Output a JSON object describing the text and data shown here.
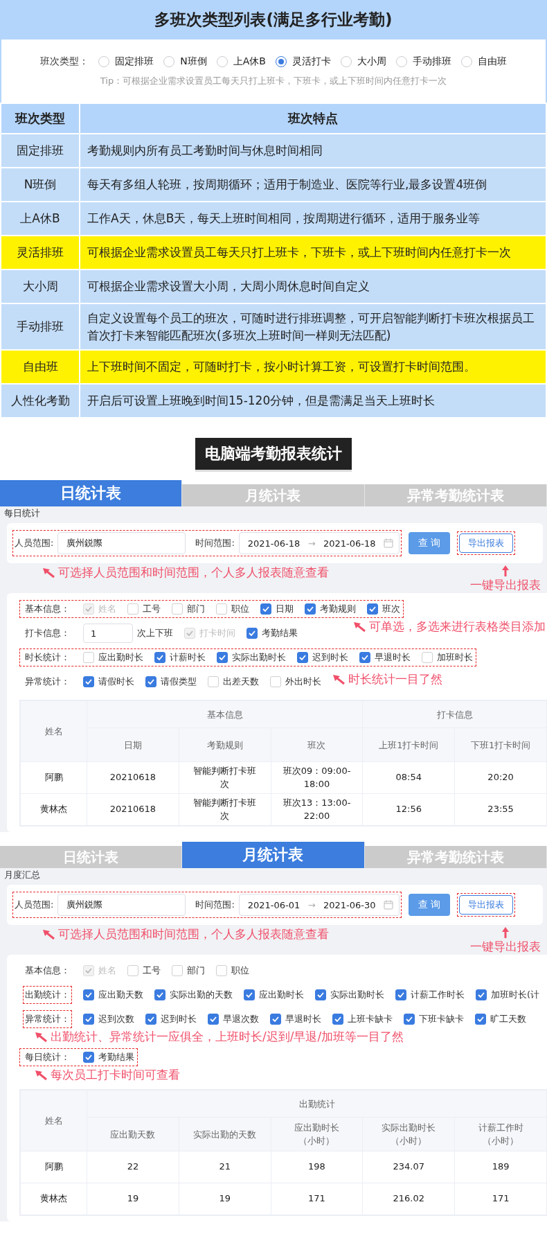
{
  "title": "多班次类型列表(满足多行业考勤)",
  "shift_selector": {
    "label": "班次类型：",
    "options": [
      {
        "label": "固定排班",
        "selected": false
      },
      {
        "label": "N班倒",
        "selected": false
      },
      {
        "label": "上A休B",
        "selected": false
      },
      {
        "label": "灵活打卡",
        "selected": true
      },
      {
        "label": "大小周",
        "selected": false
      },
      {
        "label": "手动排班",
        "selected": false
      },
      {
        "label": "自由班",
        "selected": false
      }
    ],
    "tip": "Tip：可根据企业需求设置员工每天只打上班卡，下班卡，或上下班时间内任意打卡一次"
  },
  "shift_table": {
    "columns": [
      "班次类型",
      "班次特点"
    ],
    "rows": [
      {
        "type": "固定排班",
        "feature": "考勤规则内所有员工考勤时间与休息时间相同",
        "highlighted": false
      },
      {
        "type": "N班倒",
        "feature": "每天有多组人轮班，按周期循环；适用于制造业、医院等行业,最多设置4班倒",
        "highlighted": false
      },
      {
        "type": "上A休B",
        "feature": "工作A天，休息B天，每天上班时间相同，按周期进行循环，适用于服务业等",
        "highlighted": false
      },
      {
        "type": "灵活排班",
        "feature": "可根据企业需求设置员工每天只打上班卡，下班卡，或上下班时间内任意打卡一次",
        "highlighted": true
      },
      {
        "type": "大小周",
        "feature": "可根据企业需求设置大小周，大周小周休息时间自定义",
        "highlighted": false
      },
      {
        "type": "手动排班",
        "feature": "自定义设置每个员工的班次，可随时进行排班调整，可开启智能判断打卡班次根据员工首次打卡来智能匹配班次(多班次上班时间一样则无法匹配)",
        "highlighted": false
      },
      {
        "type": "自由班",
        "feature": "上下班时间不固定，可随时打卡，按小时计算工资，可设置打卡时间范围。",
        "highlighted": true
      },
      {
        "type": "人性化考勤",
        "feature": "开启后可设置上班晚到时间15-120分钟，但是需满足当天上班时长",
        "highlighted": false
      }
    ]
  },
  "section_title": "电脑端考勤报表统计",
  "daily_report": {
    "tabs": [
      {
        "label": "日统计表",
        "selected": true
      },
      {
        "label": "月统计表",
        "selected": false
      },
      {
        "label": "异常考勤统计表",
        "selected": false
      }
    ],
    "subtitle": "每日统计",
    "filter": {
      "person_label": "人员范围:",
      "person_value": "廣州鋭際",
      "time_label": "时间范围:",
      "start": "2021-06-18",
      "range_arrow": "→",
      "end": "2021-06-18",
      "query_button": "查 询",
      "export_button": "导出报表"
    },
    "filter_note": "可选择人员范围和时间范围，个人多人报表随意查看",
    "export_note": "一键导出报表",
    "option_groups": [
      {
        "kind": "checks",
        "label": "基本信息：",
        "row_outlined": true,
        "label_outlined": false,
        "note": {
          "kind": "under-right",
          "text": "可单选，多选来进行表格类目添加"
        },
        "items": [
          {
            "label": "姓名",
            "checked": true,
            "disabled": true
          },
          {
            "label": "工号",
            "checked": false,
            "disabled": false
          },
          {
            "label": "部门",
            "checked": false,
            "disabled": false
          },
          {
            "label": "职位",
            "checked": false,
            "disabled": false
          },
          {
            "label": "日期",
            "checked": true,
            "disabled": false
          },
          {
            "label": "考勤规则",
            "checked": true,
            "disabled": false
          },
          {
            "label": "班次",
            "checked": true,
            "disabled": false
          }
        ]
      },
      {
        "kind": "count",
        "label": "打卡信息：",
        "row_outlined": false,
        "label_outlined": false,
        "value": "1",
        "suffix": "次上下班",
        "items": [
          {
            "label": "打卡时间",
            "checked": true,
            "disabled": true
          },
          {
            "label": "考勤结果",
            "checked": true,
            "disabled": false
          }
        ]
      },
      {
        "kind": "checks",
        "label": "时长统计：",
        "row_outlined": true,
        "label_outlined": false,
        "note": {
          "kind": "under-middle",
          "text": "时长统计一目了然"
        },
        "items": [
          {
            "label": "应出勤时长",
            "checked": false,
            "disabled": false
          },
          {
            "label": "计薪时长",
            "checked": true,
            "disabled": false
          },
          {
            "label": "实际出勤时长",
            "checked": true,
            "disabled": false
          },
          {
            "label": "迟到时长",
            "checked": true,
            "disabled": false
          },
          {
            "label": "早退时长",
            "checked": true,
            "disabled": false
          },
          {
            "label": "加班时长",
            "checked": false,
            "disabled": false
          }
        ]
      },
      {
        "kind": "checks",
        "label": "异常统计：",
        "row_outlined": false,
        "label_outlined": false,
        "items": [
          {
            "label": "请假时长",
            "checked": true,
            "disabled": false
          },
          {
            "label": "请假类型",
            "checked": true,
            "disabled": false
          },
          {
            "label": "出差天数",
            "checked": false,
            "disabled": false
          },
          {
            "label": "外出时长",
            "checked": false,
            "disabled": false
          }
        ]
      }
    ],
    "table": {
      "first_column": "姓名",
      "groups": [
        {
          "label": "基本信息",
          "columns": [
            {
              "label": "日期"
            },
            {
              "label": "考勤规则"
            },
            {
              "label": "班次"
            }
          ]
        },
        {
          "label": "打卡信息",
          "columns": [
            {
              "label": "上班1打卡时间"
            },
            {
              "label": "下班1打卡时间"
            }
          ]
        }
      ],
      "rows": [
        {
          "cells": [
            "阿鹏",
            "20210618",
            "智能判断打卡班次",
            "班次09：09:00-18:00",
            "08:54",
            "20:20"
          ]
        },
        {
          "cells": [
            "黄林杰",
            "20210618",
            "智能判断打卡班次",
            "班次13：13:00-22:00",
            "12:56",
            "23:55"
          ]
        }
      ]
    }
  },
  "monthly_report": {
    "tabs": [
      {
        "label": "日统计表",
        "selected": false
      },
      {
        "label": "月统计表",
        "selected": true
      },
      {
        "label": "异常考勤统计表",
        "selected": false
      }
    ],
    "subtitle": "月度汇总",
    "filter": {
      "person_label": "人员范围:",
      "person_value": "廣州鋭際",
      "time_label": "时间范围:",
      "start": "2021-06-01",
      "range_arrow": "→",
      "end": "2021-06-30",
      "query_button": "查 询",
      "export_button": "导出报表"
    },
    "filter_note": "可选择人员范围和时间范围，个人多人报表随意查看",
    "export_note": "一键导出报表",
    "option_groups": [
      {
        "kind": "checks",
        "label": "基本信息：",
        "row_outlined": false,
        "label_outlined": false,
        "items": [
          {
            "label": "姓名",
            "checked": true,
            "disabled": true
          },
          {
            "label": "工号",
            "checked": false,
            "disabled": false
          },
          {
            "label": "部门",
            "checked": false,
            "disabled": false
          },
          {
            "label": "职位",
            "checked": false,
            "disabled": false
          }
        ]
      },
      {
        "kind": "checks",
        "label": "出勤统计：",
        "row_outlined": false,
        "label_outlined": true,
        "items": [
          {
            "label": "应出勤天数",
            "checked": true,
            "disabled": false
          },
          {
            "label": "实际出勤的天数",
            "checked": true,
            "disabled": false
          },
          {
            "label": "应出勤时长",
            "checked": true,
            "disabled": false
          },
          {
            "label": "实际出勤时长",
            "checked": true,
            "disabled": false
          },
          {
            "label": "计薪工作时长",
            "checked": true,
            "disabled": false
          },
          {
            "label": "加班时长(计",
            "checked": true,
            "disabled": false
          }
        ]
      },
      {
        "kind": "checks",
        "label": "异常统计：",
        "row_outlined": false,
        "label_outlined": true,
        "note": {
          "kind": "under-left",
          "text": "出勤统计、异常统计一应俱全，上班时长/迟到/早退/加班等一目了然"
        },
        "items": [
          {
            "label": "迟到次数",
            "checked": true,
            "disabled": false
          },
          {
            "label": "迟到时长",
            "checked": true,
            "disabled": false
          },
          {
            "label": "早退次数",
            "checked": true,
            "disabled": false
          },
          {
            "label": "早退时长",
            "checked": true,
            "disabled": false
          },
          {
            "label": "上班卡缺卡",
            "checked": true,
            "disabled": false
          },
          {
            "label": "下班卡缺卡",
            "checked": true,
            "disabled": false
          },
          {
            "label": "旷工天数",
            "checked": true,
            "disabled": false
          }
        ]
      },
      {
        "kind": "checks",
        "label": "每日统计：",
        "row_outlined": true,
        "label_outlined": false,
        "note": {
          "kind": "under-left",
          "text": "每次员工打卡时间可查看"
        },
        "items": [
          {
            "label": "考勤结果",
            "checked": true,
            "disabled": false
          }
        ]
      }
    ],
    "table": {
      "first_column": "姓名",
      "groups": [
        {
          "label": "出勤统计",
          "columns": [
            {
              "label": "应出勤天数"
            },
            {
              "label": "实际出勤的天数"
            },
            {
              "label": "应出勤时长",
              "unit": "（小时）"
            },
            {
              "label": "实际出勤时长",
              "unit": "（小时）"
            },
            {
              "label": "计薪工作时",
              "unit": "（小时）"
            }
          ]
        }
      ],
      "rows": [
        {
          "cells": [
            "阿鹏",
            "22",
            "21",
            "198",
            "234.07",
            "189"
          ]
        },
        {
          "cells": [
            "黄林杰",
            "19",
            "19",
            "171",
            "216.02",
            "171"
          ]
        }
      ]
    }
  }
}
